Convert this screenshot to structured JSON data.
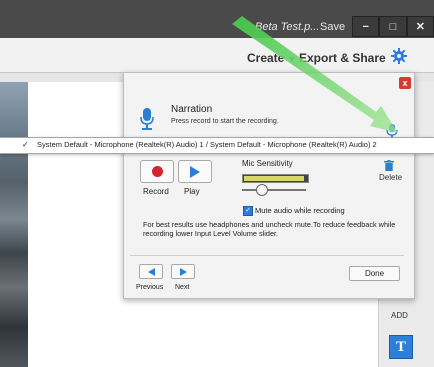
{
  "window": {
    "doc_title": "Beta Test.p...",
    "save_label": "Save",
    "controls": [
      "−",
      "□",
      "✕"
    ]
  },
  "menubar": {
    "create_label": "Create",
    "export_label": "Export & Share"
  },
  "panel": {
    "close_label": "x",
    "title": "Narration",
    "subtitle": "Press record to start the recording.",
    "record_label": "Record",
    "play_label": "Play",
    "mic_sensitivity_label": "Mic Sensitivity",
    "mic_level": 0.95,
    "mic_sensitivity_value": 0.3,
    "delete_label": "Delete",
    "mute_label": "Mute audio while recording",
    "mute_checked": true,
    "hint": "For best results use headphones and uncheck mute.To reduce feedback while recording lower Input Level Volume slider.",
    "previous_label": "Previous",
    "next_label": "Next",
    "done_label": "Done"
  },
  "dropdown": {
    "selected_check": "✓",
    "selected_text": "System Default - Microphone (Realtek(R) Audio) 1 / System Default - Microphone (Realtek(R) Audio) 2"
  },
  "right_panel": {
    "add_label": "ADD",
    "text_tool_label": "T"
  },
  "colors": {
    "accent": "#2a7be4",
    "record": "#d2252d",
    "close": "#d73a2f",
    "annotation_arrow": "#6ed36a"
  }
}
